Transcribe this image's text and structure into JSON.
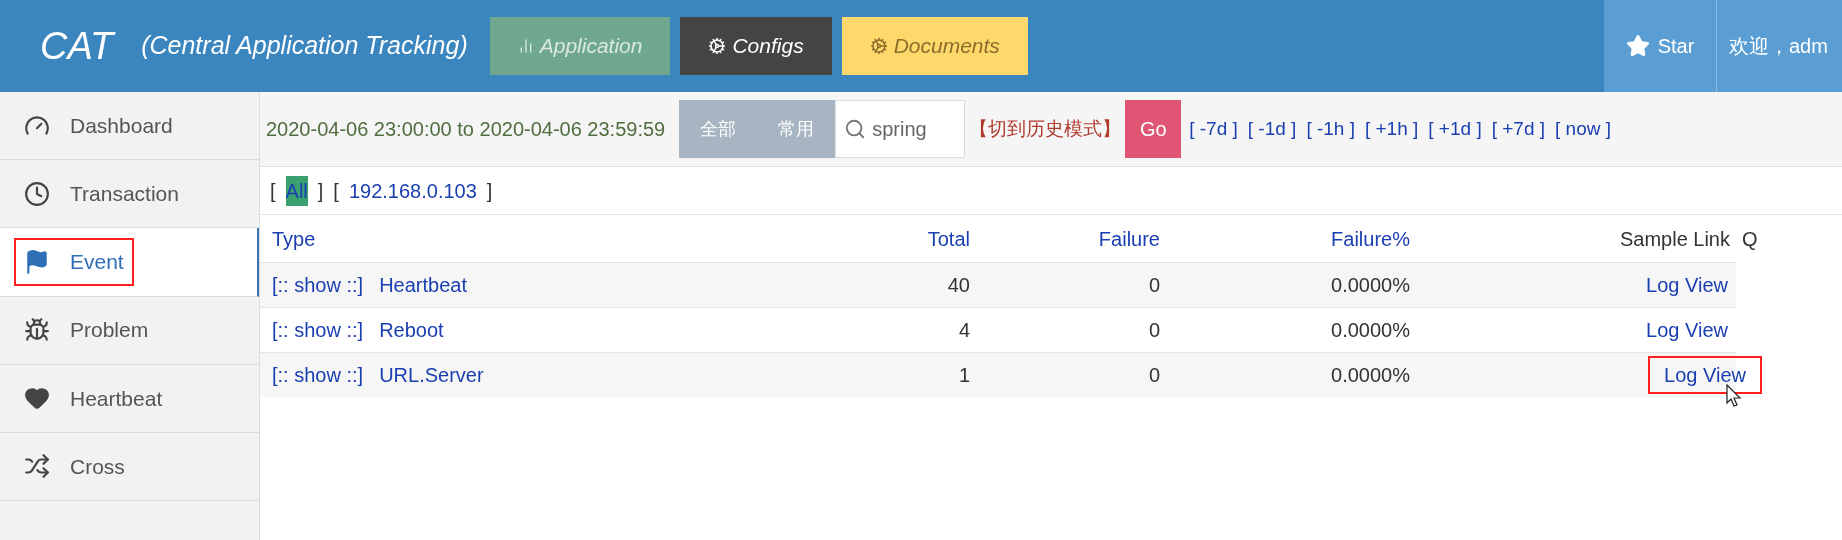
{
  "header": {
    "logo": "CAT",
    "subtitle": "(Central Application Tracking)",
    "nav": [
      {
        "label": "Application",
        "kind": "application"
      },
      {
        "label": "Configs",
        "kind": "configs"
      },
      {
        "label": "Documents",
        "kind": "documents"
      }
    ],
    "star": "Star",
    "welcome": "欢迎，adm"
  },
  "sidebar": {
    "items": [
      {
        "label": "Dashboard",
        "kind": "dashboard",
        "selected": false,
        "highlighted": false
      },
      {
        "label": "Transaction",
        "kind": "clock",
        "selected": false,
        "highlighted": false
      },
      {
        "label": "Event",
        "kind": "flag",
        "selected": true,
        "highlighted": true
      },
      {
        "label": "Problem",
        "kind": "bug",
        "selected": false,
        "highlighted": false
      },
      {
        "label": "Heartbeat",
        "kind": "heart",
        "selected": false,
        "highlighted": false
      },
      {
        "label": "Cross",
        "kind": "shuffle",
        "selected": false,
        "highlighted": false
      }
    ]
  },
  "toolbar": {
    "time_range": "2020-04-06 23:00:00 to 2020-04-06 23:59:59",
    "modes": [
      "全部",
      "常用"
    ],
    "search": {
      "value": "spring"
    },
    "history_mode": "【切到历史模式】",
    "go": "Go",
    "steps": [
      "[ -7d ]",
      "[ -1d ]",
      "[ -1h ]",
      "[ +1h ]",
      "[ +1d ]",
      "[ +7d ]",
      "[ now ]"
    ]
  },
  "machines": [
    {
      "open": "[",
      "label": "All",
      "close": "]",
      "selected": true
    },
    {
      "open": "[",
      "label": "192.168.0.103",
      "close": "]",
      "selected": false
    }
  ],
  "table": {
    "columns": [
      "Type",
      "Total",
      "Failure",
      "Failure%",
      "Sample Link",
      "Q"
    ],
    "rows": [
      {
        "show": "[:: show ::]",
        "type": "Heartbeat",
        "total": "40",
        "failure": "0",
        "failure_pct": "0.0000%",
        "link": "Log View",
        "highlighted": false
      },
      {
        "show": "[:: show ::]",
        "type": "Reboot",
        "total": "4",
        "failure": "0",
        "failure_pct": "0.0000%",
        "link": "Log View",
        "highlighted": false
      },
      {
        "show": "[:: show ::]",
        "type": "URL.Server",
        "total": "1",
        "failure": "0",
        "failure_pct": "0.0000%",
        "link": "Log View",
        "highlighted": true
      }
    ]
  }
}
